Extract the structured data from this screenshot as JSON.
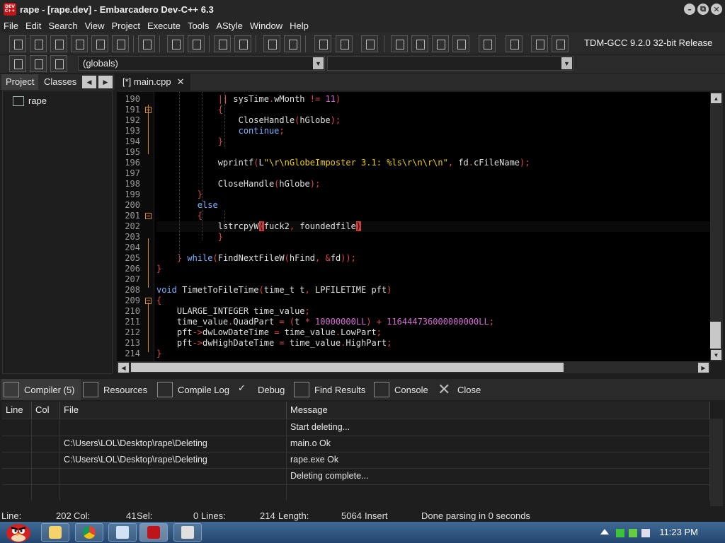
{
  "window": {
    "title": "rape - [rape.dev] - Embarcadero Dev-C++ 6.3",
    "app_icon_label": "DEV C++",
    "min_glyph": "–",
    "max_glyph": "⧉",
    "close_glyph": "✕"
  },
  "menu": [
    "File",
    "Edit",
    "Search",
    "View",
    "Project",
    "Execute",
    "Tools",
    "AStyle",
    "Window",
    "Help"
  ],
  "toolbar": {
    "compiler": "TDM-GCC 9.2.0 32-bit Release",
    "globals": "(globals)"
  },
  "left_pane": {
    "tabs": [
      "Project",
      "Classes"
    ],
    "tree_root": "rape"
  },
  "editor": {
    "tab_label": "[*] main.cpp",
    "tab_close": "✕",
    "line_numbers": [
      "190",
      "191",
      "192",
      "193",
      "194",
      "195",
      "196",
      "197",
      "198",
      "199",
      "200",
      "201",
      "202",
      "203",
      "204",
      "205",
      "206",
      "207",
      "208",
      "209",
      "210",
      "211",
      "212",
      "213",
      "214"
    ]
  },
  "bottom_tabs": [
    "Compiler (5)",
    "Resources",
    "Compile Log",
    "Debug",
    "Find Results",
    "Console",
    "Close"
  ],
  "messages": {
    "columns": [
      "Line",
      "Col",
      "File",
      "Message"
    ],
    "rows": [
      {
        "line": "",
        "col": "",
        "file": "",
        "message": "Start deleting..."
      },
      {
        "line": "",
        "col": "",
        "file": "C:\\Users\\LOL\\Desktop\\rape\\Deleting",
        "message": "main.o Ok"
      },
      {
        "line": "",
        "col": "",
        "file": "C:\\Users\\LOL\\Desktop\\rape\\Deleting",
        "message": "rape.exe Ok"
      },
      {
        "line": "",
        "col": "",
        "file": "",
        "message": "Deleting complete..."
      },
      {
        "line": "",
        "col": "",
        "file": "",
        "message": ""
      }
    ]
  },
  "status": {
    "line_label": "Line:",
    "line_value": "202",
    "col_label": "Col:",
    "col_value": "41",
    "sel_label": "Sel:",
    "sel_value": "0",
    "lines_label": "Lines:",
    "lines_value": "214",
    "length_label": "Length:",
    "length_value": "5064",
    "mode": "Insert",
    "message": "Done parsing in 0 seconds"
  },
  "taskbar": {
    "clock": "11:23 PM"
  }
}
